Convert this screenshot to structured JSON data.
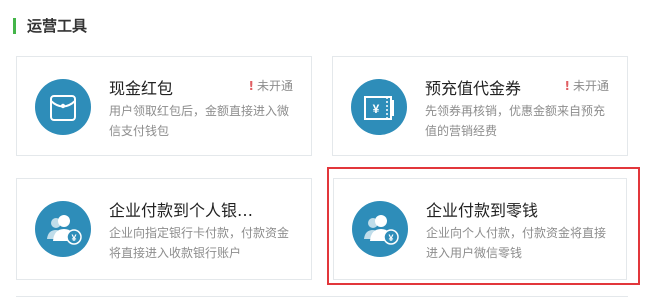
{
  "section": {
    "title": "运营工具"
  },
  "cards": [
    {
      "title": "现金红包",
      "desc": "用户领取红包后，金额直接进入微信支付钱包",
      "status": "未开通",
      "icon": "red-envelope-icon"
    },
    {
      "title": "预充值代金券",
      "desc": "先领券再核销，优惠金额来自预充值的营销经费",
      "status": "未开通",
      "icon": "voucher-icon"
    },
    {
      "title": "企业付款到个人银…",
      "desc": "企业向指定银行卡付款，付款资金将直接进入收款银行账户",
      "icon": "enterprise-payment-icon"
    },
    {
      "title": "企业付款到零钱",
      "desc": "企业向个人付款，付款资金将直接进入用户微信零钱",
      "icon": "enterprise-payment-icon"
    }
  ],
  "status_mark": "!",
  "colors": {
    "accent": "#44b549",
    "icon_bg": "#2e8db9",
    "warning": "#e15f63",
    "highlight": "#e2363b"
  }
}
